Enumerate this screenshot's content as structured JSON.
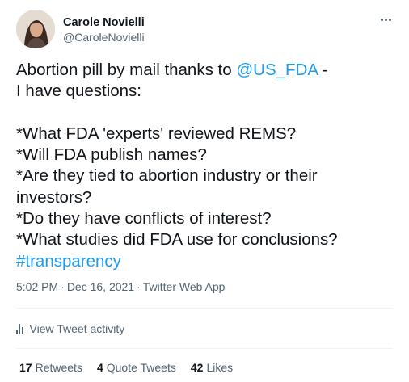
{
  "author": {
    "display_name": "Carole Novielli",
    "handle": "@CaroleNovielli"
  },
  "tweet": {
    "line1_prefix": "Abortion pill by mail thanks to ",
    "mention": "@US_FDA",
    "line1_suffix": " -",
    "line2": "I have questions:",
    "questions": [
      "*What FDA 'experts' reviewed REMS?",
      "*Will FDA publish names?",
      "*Are they tied to abortion industry or their investors?",
      "*Do they have conflicts of interest?",
      "*What studies did FDA use for conclusions?"
    ],
    "hashtag": "#transparency"
  },
  "meta": {
    "time": "5:02 PM",
    "date": "Dec 16, 2021",
    "source": "Twitter Web App",
    "separator": "·"
  },
  "activity": {
    "label": "View Tweet activity",
    "icon": "bar-chart-icon"
  },
  "stats": {
    "retweets_count": "17",
    "retweets_label": "Retweets",
    "quotes_count": "4",
    "quotes_label": "Quote Tweets",
    "likes_count": "42",
    "likes_label": "Likes"
  },
  "colors": {
    "link": "#1d9bf0",
    "secondary_text": "#536471",
    "primary_text": "#0f1419",
    "divider": "#eff3f4"
  },
  "icons": {
    "more": "more-horizontal-icon"
  }
}
